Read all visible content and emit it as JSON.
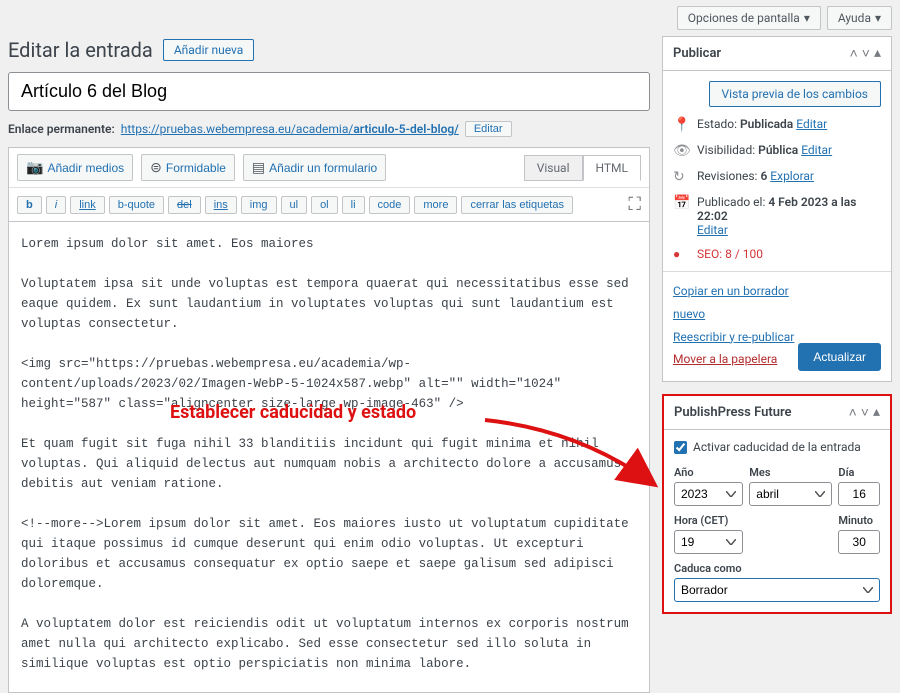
{
  "top": {
    "screen_options": "Opciones de pantalla",
    "help": "Ayuda"
  },
  "heading": {
    "title": "Editar la entrada",
    "add_new": "Añadir nueva"
  },
  "title": "Artículo 6 del Blog",
  "permalink": {
    "label": "Enlace permanente:",
    "base": "https://pruebas.webempresa.eu/academia/",
    "slug": "articulo-5-del-blog/",
    "edit": "Editar"
  },
  "media": {
    "add_media": "Añadir medios",
    "formidable": "Formidable",
    "add_form": "Añadir un formulario"
  },
  "tabs": {
    "visual": "Visual",
    "html": "HTML"
  },
  "qt": {
    "b": "b",
    "i": "i",
    "link": "link",
    "bquote": "b-quote",
    "del": "del",
    "ins": "ins",
    "img": "img",
    "ul": "ul",
    "ol": "ol",
    "li": "li",
    "code": "code",
    "more": "more",
    "close": "cerrar las etiquetas"
  },
  "content": "Lorem ipsum dolor sit amet. Eos maiores\n\nVoluptatem ipsa sit unde voluptas est tempora quaerat qui necessitatibus esse sed eaque quidem. Ex sunt laudantium in voluptates voluptas qui sunt laudantium est voluptas consectetur.\n\n<img src=\"https://pruebas.webempresa.eu/academia/wp-content/uploads/2023/02/Imagen-WebP-5-1024x587.webp\" alt=\"\" width=\"1024\" height=\"587\" class=\"aligncenter size-large wp-image-463\" />\n\nEt quam fugit sit fuga nihil 33 blanditiis incidunt qui fugit minima et nihil voluptas. Qui aliquid delectus aut numquam nobis a architecto dolore a accusamus debitis aut veniam ratione.\n\n<!--more-->Lorem ipsum dolor sit amet. Eos maiores iusto ut voluptatum cupiditate qui itaque possimus id cumque deserunt qui enim odio voluptas. Ut excepturi doloribus et accusamus consequatur ex optio saepe et saepe galisum sed adipisci doloremque.\n\nA voluptatem dolor est reiciendis odit ut voluptatum internos ex corporis nostrum amet nulla qui architecto explicabo. Sed esse consectetur sed illo soluta in similique voluptas est optio perspiciatis non minima labore.\n\nVoluptatem ipsa sit unde voluptas est tempora quaerat qui necessitatibus esse sed eaque quidem. Ex sunt laudantium in voluptates voluptas qui sunt laudantium est voluptas consectetur.\n\nEt quam fugit sit fuga nihil 33 blanditiis incidunt qui fugit minima et nihil voluptas. Qui aliquid delectus aut numquam nobis a architecto dolore a accusamus debitis aut veniam",
  "annotation": "Establecer caducidad y estado",
  "publish": {
    "title": "Publicar",
    "preview": "Vista previa de los cambios",
    "status_label": "Estado:",
    "status_value": "Publicada",
    "status_edit": "Editar",
    "visibility_label": "Visibilidad:",
    "visibility_value": "Pública",
    "visibility_edit": "Editar",
    "revisions_label": "Revisiones:",
    "revisions_count": "6",
    "revisions_explore": "Explorar",
    "published_label": "Publicado el:",
    "published_date": "4 Feb 2023 a las 22:02",
    "published_edit": "Editar",
    "seo_label": "SEO:",
    "seo_score": "8 / 100",
    "copy_draft": "Copiar en un borrador nuevo",
    "rewrite": "Reescribir y re-publicar",
    "trash": "Mover a la papelera",
    "update": "Actualizar"
  },
  "future": {
    "title": "PublishPress Future",
    "enable": "Activar caducidad de la entrada",
    "year_label": "Año",
    "year_value": "2023",
    "month_label": "Mes",
    "month_value": "abril",
    "day_label": "Día",
    "day_value": "16",
    "hour_label": "Hora (CET)",
    "hour_value": "19",
    "minute_label": "Minuto",
    "minute_value": "30",
    "expire_as_label": "Caduca como",
    "expire_as_value": "Borrador"
  }
}
